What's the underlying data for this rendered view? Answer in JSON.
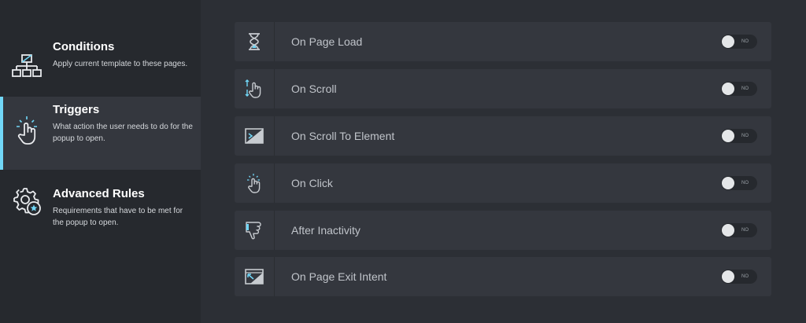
{
  "sidebar": {
    "items": [
      {
        "title": "Conditions",
        "description": "Apply current template to these pages.",
        "icon": "sitemap-icon",
        "active": false
      },
      {
        "title": "Triggers",
        "description": "What action the user needs to do for the popup to open.",
        "icon": "hand-tap-icon",
        "active": true
      },
      {
        "title": "Advanced Rules",
        "description": "Requirements that have to be met for the popup to open.",
        "icon": "gear-star-icon",
        "active": false
      }
    ]
  },
  "triggers": [
    {
      "label": "On Page Load",
      "icon": "hourglass-icon",
      "toggle": "NO"
    },
    {
      "label": "On Scroll",
      "icon": "scroll-hand-icon",
      "toggle": "NO"
    },
    {
      "label": "On Scroll To Element",
      "icon": "scroll-to-element-icon",
      "toggle": "NO"
    },
    {
      "label": "On Click",
      "icon": "click-hand-icon",
      "toggle": "NO"
    },
    {
      "label": "After Inactivity",
      "icon": "inactivity-hand-icon",
      "toggle": "NO"
    },
    {
      "label": "On Page Exit Intent",
      "icon": "exit-intent-icon",
      "toggle": "NO"
    }
  ],
  "colors": {
    "accent": "#71d7f7",
    "background": "#2c2f35",
    "panel": "#34373e"
  }
}
